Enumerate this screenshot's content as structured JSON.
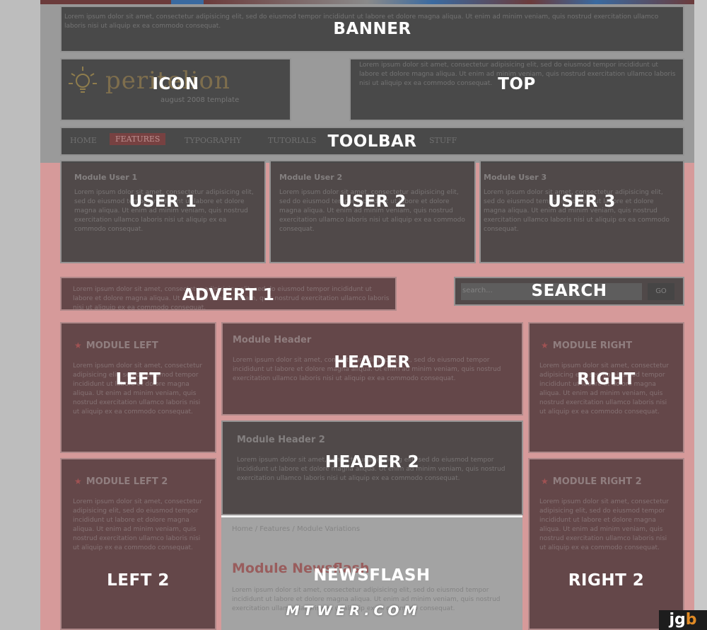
{
  "regions": {
    "banner": "BANNER",
    "icon": "ICON",
    "top": "TOP",
    "toolbar": "TOOLBAR",
    "user1": "USER 1",
    "user2": "USER 2",
    "user3": "USER 3",
    "advert1": "ADVERT 1",
    "search": "SEARCH",
    "left": "LEFT",
    "header": "HEADER",
    "right": "RIGHT",
    "header2": "HEADER 2",
    "left2": "LEFT 2",
    "newsflash": "NEWSFLASH",
    "right2": "RIGHT 2"
  },
  "logo": {
    "text": "peritelion",
    "subtitle": "august 2008 template"
  },
  "nav": [
    "HOME",
    "FEATURES",
    "TYPOGRAPHY",
    "TUTORIALS",
    "STUFF"
  ],
  "modules": {
    "user1_title": "Module User 1",
    "user2_title": "Module User 2",
    "user3_title": "Module User 3",
    "left_title": "MODULE LEFT",
    "left2_title": "MODULE LEFT 2",
    "right_title": "MODULE RIGHT",
    "right2_title": "MODULE RIGHT 2",
    "header_title": "Module Header",
    "header2_title": "Module Header 2",
    "newsflash_title": "Module Newsflash"
  },
  "search": {
    "placeholder": "search...",
    "button": "GO"
  },
  "breadcrumb": "Home  /  Features  /  Module Variations",
  "lorem": "Lorem ipsum dolor sit amet, consectetur adipisicing elit, sed do eiusmod tempor incididunt ut labore et dolore magna aliqua. Ut enim ad minim veniam, quis nostrud exercitation ullamco laboris nisi ut aliquip ex ea commodo consequat.",
  "watermark": "MTWER.COM",
  "corner_logo": {
    "part1": "jg",
    "part2": "b"
  }
}
